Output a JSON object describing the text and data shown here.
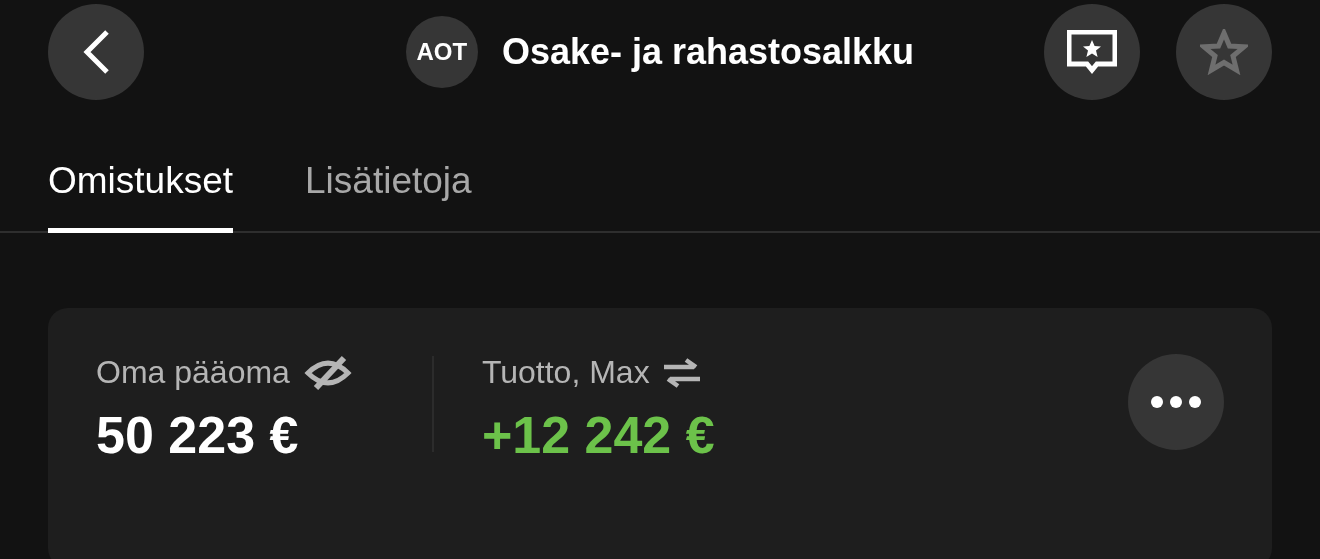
{
  "header": {
    "logo": "AOT",
    "title": "Osake- ja rahastosalkku",
    "favorited": false
  },
  "tabs": [
    {
      "label": "Omistukset",
      "selected": true
    },
    {
      "label": "Lisätietoja",
      "selected": false
    }
  ],
  "summary": {
    "equity": {
      "label": "Oma pääoma",
      "value": "50 223 €",
      "hidden": false
    },
    "return": {
      "label": "Tuotto, Max",
      "value": "+12 242 €",
      "positive": true
    }
  }
}
